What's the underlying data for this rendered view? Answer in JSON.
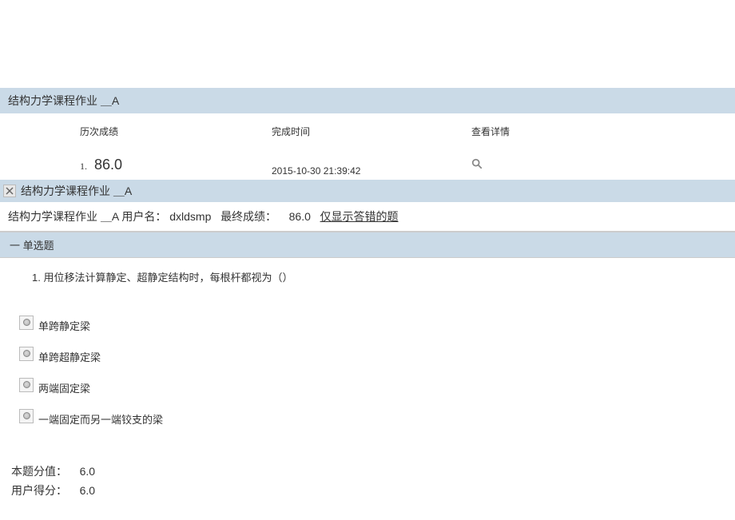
{
  "header": {
    "title": "结构力学课程作业 ＿A"
  },
  "history": {
    "col1": "历次成绩",
    "col2": "完成时间",
    "col3": "查看详情"
  },
  "row": {
    "index": "1.",
    "score": "86.0",
    "time": "2015-10-30 21:39:42"
  },
  "subheader": {
    "title": "结构力学课程作业 ＿A"
  },
  "info": {
    "assignment": "结构力学课程作业 ＿A",
    "user_label": "用户名：",
    "user_value": "dxldsmp",
    "final_label": "最终成绩：",
    "final_value": "86.0",
    "filter_link": "仅显示答错的题"
  },
  "section": {
    "title": "一    单选题"
  },
  "question": {
    "text": "1.  用位移法计算静定、超静定结构时，每根杆都视为（）"
  },
  "options": [
    "单跨静定梁",
    "单跨超静定梁",
    "两端固定梁",
    "一端固定而另一端铰支的梁"
  ],
  "footer": {
    "score_label": "本题分值：",
    "score_value": "6.0",
    "user_label": "用户得分：",
    "user_value": "6.0"
  }
}
